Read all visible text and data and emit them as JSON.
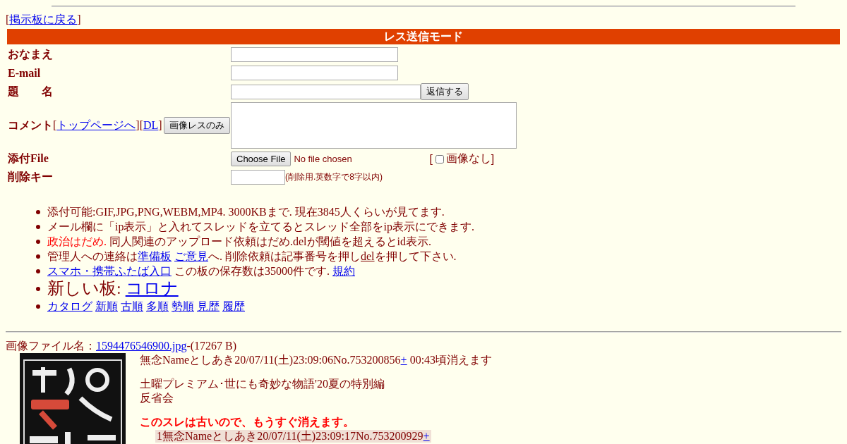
{
  "back_link": {
    "open": "[",
    "link": "掲示板に戻る",
    "close": "]"
  },
  "form": {
    "title": "レス送信モード",
    "name_label": "おなまえ",
    "email_label": "E-mail",
    "subject_label": "題　　名",
    "submit_button": "返信する",
    "comment_label": "コメント",
    "comment_segments": [
      {
        "kind": "text",
        "text": "["
      },
      {
        "kind": "link",
        "text": "トップページへ"
      },
      {
        "kind": "text",
        "text": "]["
      },
      {
        "kind": "link",
        "text": "DL"
      },
      {
        "kind": "text",
        "text": "]"
      }
    ],
    "image_only_button": "画像レスのみ",
    "file_label": "添付File",
    "file_button": "Choose File",
    "file_status": "No file chosen",
    "no_image": {
      "open": "[",
      "label": "画像なし",
      "close": "]",
      "checked": false
    },
    "delete_key_label": "削除キー",
    "delete_key_hint": "(削除用.英数字で8字以内)"
  },
  "notices": [
    {
      "kind": "normal",
      "segments": [
        {
          "kind": "text",
          "text": "添付可能:GIF,JPG,PNG,WEBM,MP4. 3000KBまで. 現在3845人くらいが見てます."
        }
      ]
    },
    {
      "kind": "normal",
      "segments": [
        {
          "kind": "text",
          "text": "メール欄に「ip表示」と入れてスレッドを立てるとスレッド全部をip表示にできます."
        }
      ]
    },
    {
      "kind": "normal",
      "segments": [
        {
          "kind": "warn",
          "text": "政治はだめ."
        },
        {
          "kind": "text",
          "text": " 同人関連のアップロード依頼はだめ.delが閾値を超えるとid表示."
        }
      ]
    },
    {
      "kind": "normal",
      "segments": [
        {
          "kind": "text",
          "text": "管理人への連絡は"
        },
        {
          "kind": "link",
          "text": "準備板"
        },
        {
          "kind": "spaced-link",
          "text": "ご意見"
        },
        {
          "kind": "text",
          "text": "へ. 削除依頼は記事番号を押し"
        },
        {
          "kind": "del",
          "text": "del"
        },
        {
          "kind": "text",
          "text": "を押して下さい."
        }
      ]
    },
    {
      "kind": "normal",
      "segments": [
        {
          "kind": "link",
          "text": "スマホ・携帯ふたば入口"
        },
        {
          "kind": "text",
          "text": " この板の保存数は35000件です. "
        },
        {
          "kind": "link",
          "text": "規約"
        }
      ]
    },
    {
      "kind": "large",
      "segments": [
        {
          "kind": "text",
          "text": "新しい板: "
        },
        {
          "kind": "link",
          "text": "コロナ"
        }
      ]
    },
    {
      "kind": "normal",
      "segments": [
        {
          "kind": "link",
          "text": "カタログ"
        },
        {
          "kind": "spaced-link",
          "text": "新順"
        },
        {
          "kind": "spaced-link",
          "text": "古順"
        },
        {
          "kind": "spaced-link",
          "text": "多順"
        },
        {
          "kind": "spaced-link",
          "text": "勢順"
        },
        {
          "kind": "spaced-link",
          "text": "見歴"
        },
        {
          "kind": "spaced-link",
          "text": "履歴"
        }
      ]
    }
  ],
  "thread": {
    "file_label": "画像ファイル名：",
    "file_link": "1594476546900.jpg",
    "file_size": "-(17267 B)",
    "thumbnail": {
      "kind": "picture"
    },
    "header": [
      {
        "kind": "text",
        "text": "無念Nameとしあき20/07/11(土)23:09:06No.753200856"
      },
      {
        "kind": "link",
        "text": "+"
      },
      {
        "kind": "text",
        "text": " 00:43頃消えます"
      }
    ],
    "body": [
      "土曜プレミアム･世にも奇妙な物語'20夏の特別編",
      "反省会"
    ],
    "warning": "このスレは古いので、もうすぐ消えます。",
    "replies": [
      {
        "segments": [
          {
            "kind": "text",
            "text": "1無念Nameとしあき20/07/11(土)23:09:17No.753200929"
          },
          {
            "kind": "link",
            "text": "+"
          }
        ]
      }
    ]
  }
}
